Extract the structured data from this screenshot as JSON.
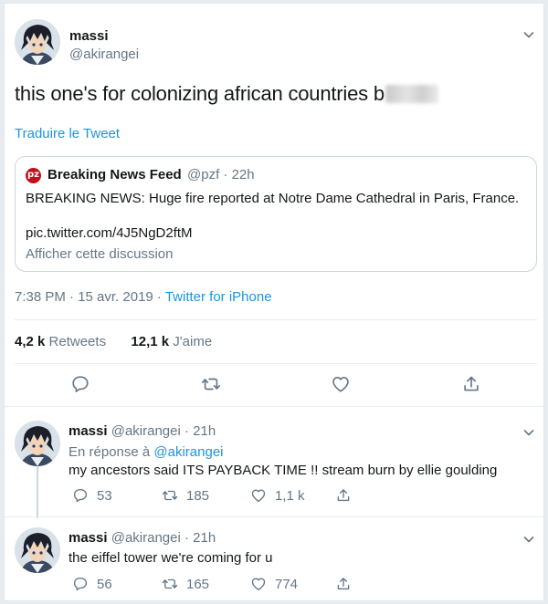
{
  "tweet": {
    "name": "massi",
    "handle": "@akirangei",
    "text": "this one's for colonizing african countries b",
    "translate": "Traduire le Tweet",
    "quoted": {
      "name": "Breaking News Feed",
      "meta": "@pzf · 22h",
      "text": "BREAKING NEWS: Huge fire reported at Notre Dame Cathedral in Paris, France.",
      "link": "pic.twitter.com/4J5NgD2ftM",
      "show": "Afficher cette discussion"
    },
    "time": "7:38 PM · 15 avr. 2019 · ",
    "source": "Twitter for iPhone",
    "retweets_count": "4,2 k",
    "retweets_label": " Retweets",
    "likes_count": "12,1 k",
    "likes_label": " J'aime"
  },
  "replies": [
    {
      "name": "massi",
      "meta": "@akirangei · 21h",
      "reply_prefix": "En réponse à ",
      "reply_to": "@akirangei",
      "text": "my ancestors said ITS PAYBACK TIME !! stream burn by ellie goulding",
      "comments": "53",
      "retweets": "185",
      "likes": "1,1 k"
    },
    {
      "name": "massi",
      "meta": "@akirangei · 21h",
      "text": "the eiffel tower we're coming for u",
      "comments": "56",
      "retweets": "165",
      "likes": "774"
    }
  ],
  "colors": {
    "link": "#1b95e0",
    "muted": "#657786",
    "text": "#14171a",
    "border": "#e6ecf0"
  },
  "icons": [
    "avatar",
    "chevron-down-icon",
    "news-logo-icon",
    "comment-icon",
    "retweet-icon",
    "like-icon",
    "share-icon"
  ]
}
